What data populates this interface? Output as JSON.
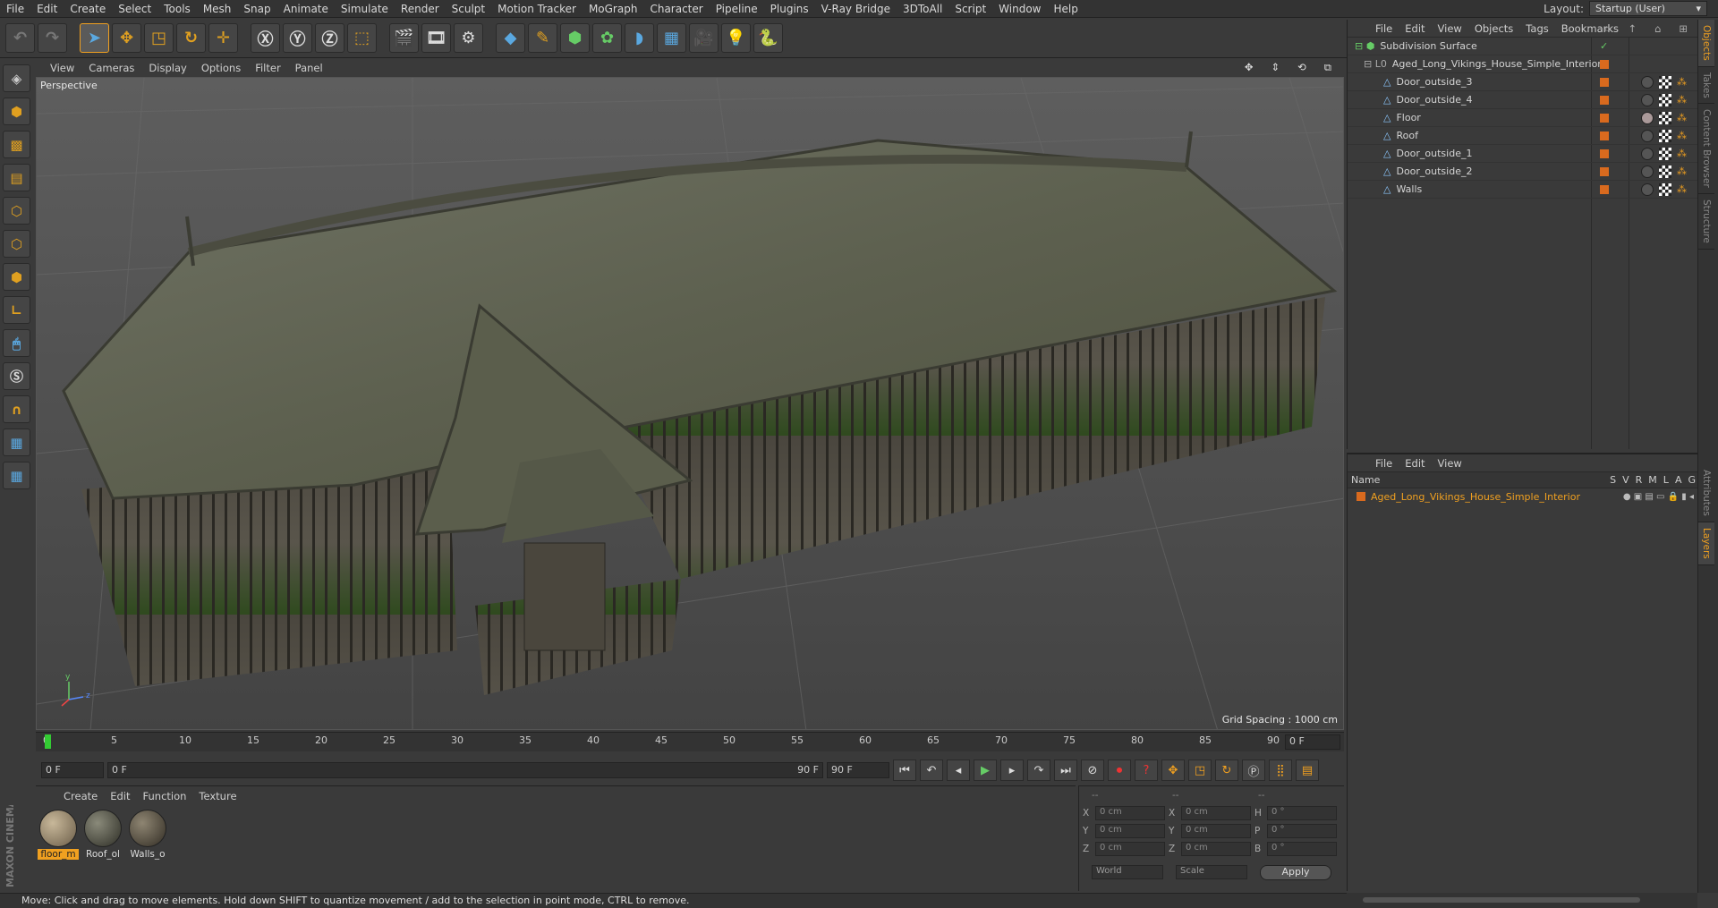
{
  "menubar": {
    "items": [
      "File",
      "Edit",
      "Create",
      "Select",
      "Tools",
      "Mesh",
      "Snap",
      "Animate",
      "Simulate",
      "Render",
      "Sculpt",
      "Motion Tracker",
      "MoGraph",
      "Character",
      "Pipeline",
      "Plugins",
      "V-Ray Bridge",
      "3DToAll",
      "Script",
      "Window",
      "Help"
    ],
    "layout_label": "Layout:",
    "layout_value": "Startup (User)"
  },
  "viewport": {
    "menu": [
      "View",
      "Cameras",
      "Display",
      "Options",
      "Filter",
      "Panel"
    ],
    "camera": "Perspective",
    "grid_spacing": "Grid Spacing : 1000 cm"
  },
  "timeline": {
    "ticks": [
      "0",
      "5",
      "10",
      "15",
      "20",
      "25",
      "30",
      "35",
      "40",
      "45",
      "50",
      "55",
      "60",
      "65",
      "70",
      "75",
      "80",
      "85",
      "90"
    ],
    "current_frame": "0 F"
  },
  "transport": {
    "start": "0 F",
    "range_start": "0 F",
    "range_end": "90 F",
    "end": "90 F"
  },
  "material_manager": {
    "menu": [
      "Create",
      "Edit",
      "Function",
      "Texture"
    ],
    "materials": [
      {
        "name": "floor_m",
        "selected": true
      },
      {
        "name": "Roof_ol",
        "selected": false
      },
      {
        "name": "Walls_o",
        "selected": false
      }
    ]
  },
  "coordinates": {
    "header": [
      "--",
      "--",
      "--"
    ],
    "rows": [
      {
        "a": "X",
        "av": "0 cm",
        "b": "X",
        "bv": "0 cm",
        "c": "H",
        "cv": "0 °"
      },
      {
        "a": "Y",
        "av": "0 cm",
        "b": "Y",
        "bv": "0 cm",
        "c": "P",
        "cv": "0 °"
      },
      {
        "a": "Z",
        "av": "0 cm",
        "b": "Z",
        "bv": "0 cm",
        "c": "B",
        "cv": "0 °"
      }
    ],
    "space": "World",
    "mode": "Scale",
    "apply": "Apply"
  },
  "status": "Move: Click and drag to move elements. Hold down SHIFT to quantize movement / add to the selection in point mode, CTRL to remove.",
  "object_manager": {
    "menu": [
      "File",
      "Edit",
      "View",
      "Objects",
      "Tags",
      "Bookmarks"
    ],
    "objects": [
      {
        "name": "Subdivision Surface",
        "indent": 0
      },
      {
        "name": "Aged_Long_Vikings_House_Simple_Interior",
        "indent": 1
      },
      {
        "name": "Door_outside_3",
        "indent": 2
      },
      {
        "name": "Door_outside_4",
        "indent": 2
      },
      {
        "name": "Floor",
        "indent": 2
      },
      {
        "name": "Roof",
        "indent": 2
      },
      {
        "name": "Door_outside_1",
        "indent": 2
      },
      {
        "name": "Door_outside_2",
        "indent": 2
      },
      {
        "name": "Walls",
        "indent": 2
      }
    ]
  },
  "layer_manager": {
    "menu": [
      "File",
      "Edit",
      "View"
    ],
    "header_name": "Name",
    "columns": [
      "S",
      "V",
      "R",
      "M",
      "L",
      "A",
      "G"
    ],
    "layers": [
      "Aged_Long_Vikings_House_Simple_Interior"
    ]
  },
  "side_tabs": [
    "Objects",
    "Takes",
    "Content Browser",
    "Structure",
    "Attributes",
    "Layers"
  ],
  "colors": {
    "accent": "#f0a020",
    "layer_text": "#f0a020",
    "tag_orange": "#d96a1e"
  }
}
